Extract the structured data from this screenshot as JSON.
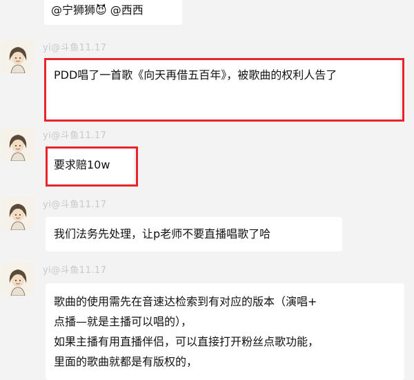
{
  "messages": [
    {
      "sender": "",
      "text": "@宁狮狮😈 @西西"
    },
    {
      "sender": "yi@斗鱼11.17",
      "text": "PDD唱了一首歌《向天再借五百年》，被歌曲的权利人告了"
    },
    {
      "sender": "yi@斗鱼11.17",
      "text": "要求赔10w"
    },
    {
      "sender": "yi@斗鱼11.17",
      "text": "我们法务先处理，让p老师不要直播唱歌了哈"
    },
    {
      "sender": "yi@斗鱼11.17",
      "lines": [
        "歌曲的使用需先在音速达检索到有对应的版本（演唱+",
        "点播—就是主播可以唱的），",
        "如果主播有用直播伴侣，可以直接打开粉丝点歌功能，",
        "里面的歌曲就都是有版权的，"
      ]
    }
  ],
  "colors": {
    "background": "#f3f3f3",
    "bubble": "#ffffff",
    "highlight_border": "#e8242a",
    "sender_text": "#c8c8c8"
  },
  "icons": {
    "avatar": "girl-avatar-icon"
  }
}
